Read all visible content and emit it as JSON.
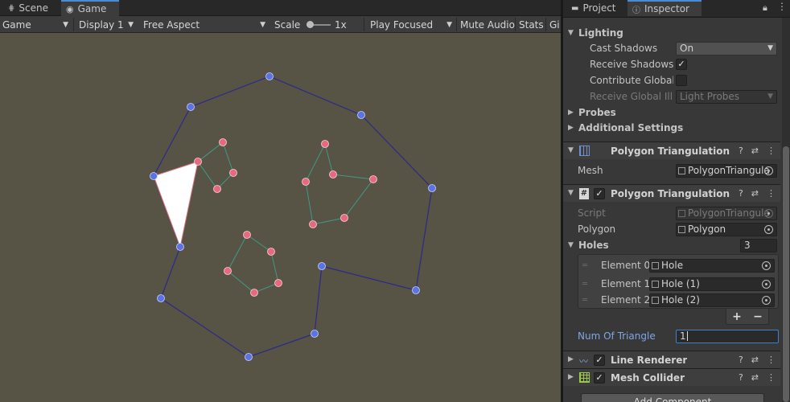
{
  "left_tabs": [
    {
      "label": "Scene"
    },
    {
      "label": "Game"
    }
  ],
  "toolbar": {
    "game_dropdown": "Game",
    "display": "Display 1",
    "aspect": "Free Aspect",
    "scale_label": "Scale",
    "scale_value": "1x",
    "play_focused": "Play Focused",
    "mute_audio": "Mute Audio",
    "stats": "Stats",
    "gizmos": "Gi"
  },
  "right_tabs": [
    {
      "label": "Project"
    },
    {
      "label": "Inspector"
    }
  ],
  "inspector": {
    "lighting": {
      "title": "Lighting",
      "cast_shadows_label": "Cast Shadows",
      "cast_shadows_value": "On",
      "receive_shadows_label": "Receive Shadows",
      "contribute_gi_label": "Contribute Global I",
      "receive_gi_label": "Receive Global Illu",
      "receive_gi_value": "Light Probes"
    },
    "probes_label": "Probes",
    "additional_settings_label": "Additional Settings",
    "mesh_filter": {
      "title": "Polygon Triangulation Wit",
      "mesh_label": "Mesh",
      "mesh_value": "PolygonTriangula"
    },
    "script_component": {
      "title": "Polygon Triangulation Wit",
      "script_label": "Script",
      "script_value": "PolygonTriangula",
      "polygon_label": "Polygon",
      "polygon_value": "Polygon",
      "holes_label": "Holes",
      "holes_count": "3",
      "holes": [
        {
          "label": "Element 0",
          "value": "Hole"
        },
        {
          "label": "Element 1",
          "value": "Hole (1)"
        },
        {
          "label": "Element 2",
          "value": "Hole (2)"
        }
      ],
      "plus": "+",
      "minus": "−",
      "num_triangle_label": "Num Of Triangle",
      "num_triangle_value": "1"
    },
    "line_renderer": {
      "title": "Line Renderer"
    },
    "mesh_collider": {
      "title": "Mesh Collider"
    },
    "add_component": "Add Component"
  },
  "colors": {
    "viewport_bg": "#575345",
    "outer_edge": "#2b2a8a",
    "outer_vertex": "#5b73e6",
    "hole_edge": "#3f9a88",
    "hole_vertex": "#e8697f",
    "triangle_fill": "#ffffff",
    "accent": "#4a8bd6"
  }
}
